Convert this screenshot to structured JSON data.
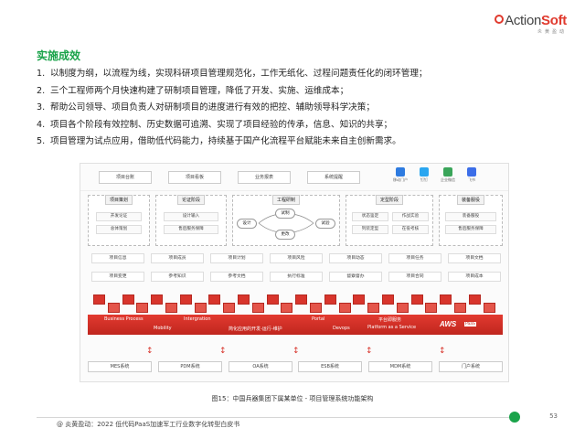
{
  "logo": {
    "brand_a": "Action",
    "brand_b": "Soft",
    "sub": "炎黄盈动"
  },
  "section_title": "实施成效",
  "items": [
    {
      "num": "1.",
      "text": "以制度为纲，以流程为线，实现科研项目管理规范化，工作无纸化、过程问题责任化的闭环管理；"
    },
    {
      "num": "2.",
      "text": "三个工程师两个月快速构建了研制项目管理，降低了开发、实施、运维成本；"
    },
    {
      "num": "3.",
      "text": "帮助公司领导、项目负责人对研制项目的进度进行有效的把控、辅助领导科学决策；"
    },
    {
      "num": "4.",
      "text": "项目各个阶段有效控制、历史数据可追溯、实现了项目经验的传承，信息、知识的共享；"
    },
    {
      "num": "5.",
      "text": "项目管理为试点应用，借助低代码能力，持续基于国产化流程平台赋能未来自主创新需求。"
    }
  ],
  "figure": {
    "top_tabs": [
      "项目台账",
      "项目看板",
      "业务报表",
      "系统提醒"
    ],
    "apps": [
      {
        "label": "移动门户",
        "color": "#2e7be0"
      },
      {
        "label": "钉钉",
        "color": "#2aa6f0"
      },
      {
        "label": "企业微信",
        "color": "#3aa55a"
      },
      {
        "label": "飞书",
        "color": "#3c6ee8"
      }
    ],
    "groups": [
      {
        "head": "项目策划",
        "items": [
          "开发论证",
          "总体策划"
        ]
      },
      {
        "head": "论证阶段",
        "items": [
          "设计输入",
          "售后服务保障"
        ]
      },
      {
        "head": "工程研制",
        "ovals": [
          "设计",
          "试制",
          "试验",
          "更改"
        ]
      },
      {
        "head": "定型阶段",
        "items": [
          "状态鉴定",
          "作战实验",
          "列装定型",
          "在役考核"
        ]
      },
      {
        "head": "装备服役",
        "items": [
          "装备服役",
          "售后服务保障"
        ]
      }
    ],
    "modules_row1": [
      "项目信息",
      "项目成员",
      "项目计划",
      "项目风险",
      "项目动态",
      "项目任务",
      "项目文档"
    ],
    "modules_row2": [
      "项目变更",
      "参考知识",
      "参考文档",
      "执行标准",
      "督察督办",
      "项目合同",
      "项目成本"
    ],
    "platform": {
      "bp": "Business Process",
      "mobility": "Mobility",
      "integration": "Intergration",
      "lowcode": "简化应用的开发-运行-维护",
      "portal": "Portal",
      "devops": "Devops",
      "paas_cn": "平台即服务",
      "paas_en": "Platform as a Service",
      "aws": "AWS",
      "paas_tag": "PaaS"
    },
    "arrow_glyph": "↕",
    "systems": [
      "MES系统",
      "PDM系统",
      "OA系统",
      "ESB系统",
      "MDM系统",
      "门户系统"
    ]
  },
  "caption": "图15：中国兵器集团下属某单位 - 项目管理系统功能架构",
  "page_number": "53",
  "footer": "@ 炎黄盈动：2022 低代码PaaS加速军工行业数字化转型白皮书",
  "colors": {
    "accent_green": "#1aa34a",
    "brand_red": "#e03a2e"
  }
}
